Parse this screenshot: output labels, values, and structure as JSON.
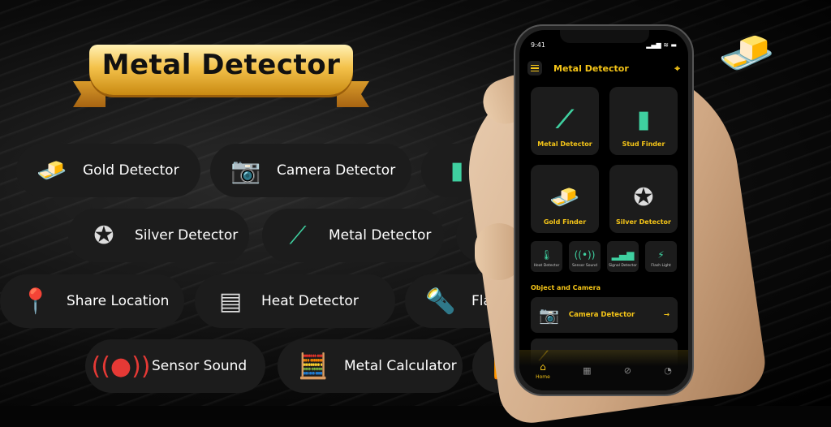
{
  "banner": {
    "title": "Metal Detector"
  },
  "features": [
    {
      "label": "Gold Detector",
      "icon": "gold-bars-icon"
    },
    {
      "label": "Camera Detector",
      "icon": "camera-icon"
    },
    {
      "label": "",
      "icon": "stud-finder-icon"
    },
    {
      "label": "Silver Detector",
      "icon": "silver-medal-icon"
    },
    {
      "label": "Metal Detector",
      "icon": "metal-wand-icon"
    },
    {
      "label": "",
      "icon": "flashlight-icon"
    },
    {
      "label": "Share Location",
      "icon": "location-pin-icon"
    },
    {
      "label": "Heat Detector",
      "icon": "heat-sensor-icon"
    },
    {
      "label": "Flash l",
      "icon": "flashlight-icon"
    },
    {
      "label": "Sensor Sound",
      "icon": "sound-waves-icon"
    },
    {
      "label": "Metal Calculator",
      "icon": "calculator-icon"
    },
    {
      "label": "",
      "icon": "wifi-location-icon"
    }
  ],
  "phone": {
    "time": "9:41",
    "header_title": "Metal Detector",
    "cards": [
      {
        "label": "Metal Detector"
      },
      {
        "label": "Stud Finder"
      },
      {
        "label": "Gold Finder"
      },
      {
        "label": "Silver Detector"
      }
    ],
    "mini_tools": [
      {
        "label": "Heat Detector"
      },
      {
        "label": "Sensor Sound"
      },
      {
        "label": "Signal Detector"
      },
      {
        "label": "Flash Light"
      }
    ],
    "section_title": "Object and Camera",
    "list": [
      {
        "label": "Camera Detector"
      }
    ],
    "nav": {
      "home": "Home"
    }
  },
  "colors": {
    "accent": "#f5c518",
    "card": "#1c1c1c",
    "green": "#3fd0a0"
  }
}
